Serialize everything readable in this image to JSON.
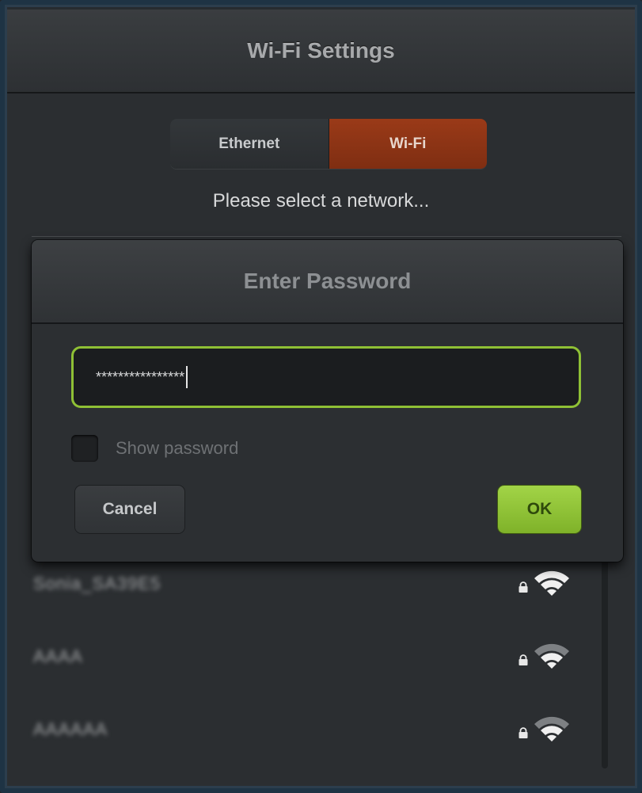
{
  "window": {
    "title": "Wi-Fi Settings"
  },
  "connection_tabs": [
    {
      "label": "Ethernet",
      "selected": false
    },
    {
      "label": "Wi-Fi",
      "selected": true
    }
  ],
  "prompt": "Please select a network...",
  "networks": [
    {
      "name": "Sonia_SA39E5",
      "secured": true,
      "signal": "full"
    },
    {
      "name": "AAAA",
      "secured": true,
      "signal": "medium"
    },
    {
      "name": "AAAAAA",
      "secured": true,
      "signal": "medium"
    }
  ],
  "dialog": {
    "title": "Enter Password",
    "password_value": "****************",
    "show_password_label": "Show password",
    "show_password_checked": false,
    "cancel_label": "Cancel",
    "ok_label": "OK"
  },
  "colors": {
    "accent_selected_tab": "#8a3414",
    "focus_border": "#8fc035",
    "ok_button": "#8fc035"
  }
}
